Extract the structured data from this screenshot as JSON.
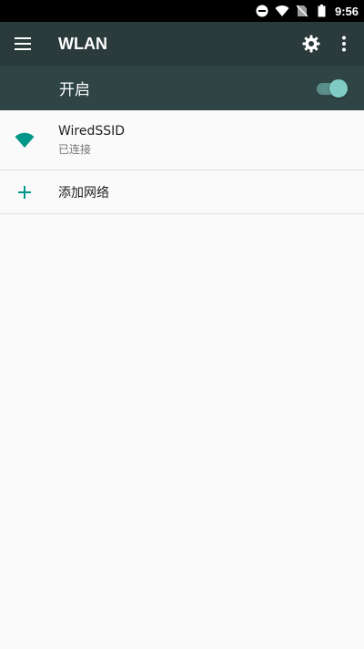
{
  "status_bar": {
    "time": "9:56",
    "icons": [
      "do-not-disturb-icon",
      "wifi-icon",
      "no-sim-icon",
      "battery-icon"
    ]
  },
  "app_bar": {
    "title": "WLAN",
    "icons": [
      "menu-icon",
      "settings-icon",
      "more-vert-icon"
    ]
  },
  "master_switch": {
    "label": "开启",
    "on": true
  },
  "networks": [
    {
      "name": "WiredSSID",
      "status": "已连接",
      "icon": "wifi-signal-icon"
    }
  ],
  "add_network": {
    "label": "添加网络",
    "icon": "add-icon"
  },
  "colors": {
    "status_bar": "#000000",
    "app_bar": "#2b3a3a",
    "switch_bar": "#2f4545",
    "accent": "#009688",
    "toggle_thumb": "#80cbc4",
    "background": "#fafafa"
  }
}
